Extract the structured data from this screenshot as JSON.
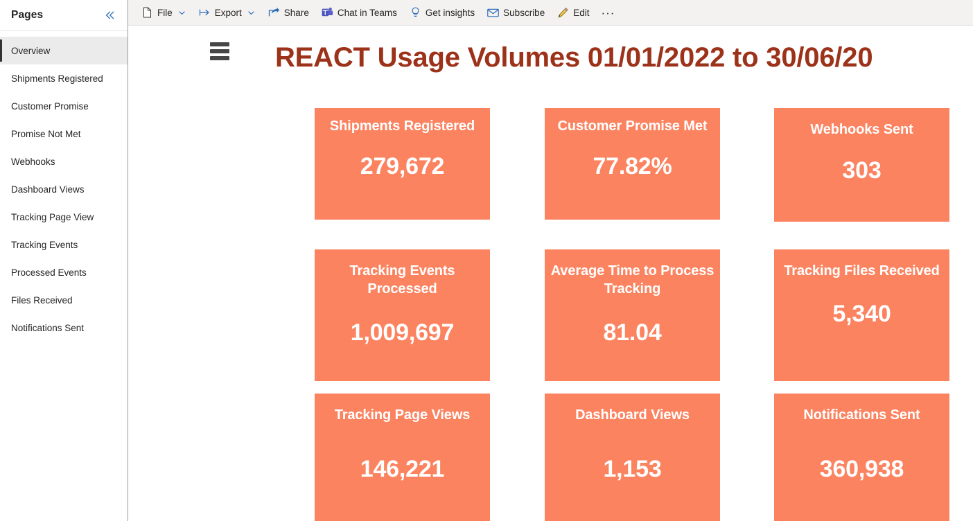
{
  "sidebar": {
    "title": "Pages",
    "collapse_icon": "double-chevron-left-icon",
    "items": [
      {
        "label": "Overview",
        "selected": true
      },
      {
        "label": "Shipments Registered",
        "selected": false
      },
      {
        "label": "Customer Promise",
        "selected": false
      },
      {
        "label": "Promise Not Met",
        "selected": false
      },
      {
        "label": "Webhooks",
        "selected": false
      },
      {
        "label": "Dashboard Views",
        "selected": false
      },
      {
        "label": "Tracking Page View",
        "selected": false
      },
      {
        "label": "Tracking Events",
        "selected": false
      },
      {
        "label": "Processed Events",
        "selected": false
      },
      {
        "label": "Files Received",
        "selected": false
      },
      {
        "label": "Notifications Sent",
        "selected": false
      }
    ]
  },
  "toolbar": {
    "file_label": "File",
    "export_label": "Export",
    "share_label": "Share",
    "chat_in_teams_label": "Chat in Teams",
    "get_insights_label": "Get insights",
    "subscribe_label": "Subscribe",
    "edit_label": "Edit",
    "overflow_label": "···",
    "icons": {
      "file": "file-icon",
      "export": "export-arrow-icon",
      "share": "share-arrow-icon",
      "teams": "teams-icon",
      "insights": "lightbulb-icon",
      "subscribe": "envelope-icon",
      "edit": "pencil-icon",
      "caret": "chevron-down-icon"
    }
  },
  "report": {
    "menu_icon": "hamburger-menu-icon",
    "title": "REACT Usage Volumes 01/01/2022 to 30/06/20",
    "title_color": "#9c3219",
    "card_color": "#fc8360",
    "card_text_color": "#ffffff",
    "cards": [
      {
        "title": "Shipments Registered",
        "value": "279,672"
      },
      {
        "title": "Customer Promise Met",
        "value": "77.82%"
      },
      {
        "title": "Webhooks Sent",
        "value": "303"
      },
      {
        "title": "Tracking Events Processed",
        "value": "1,009,697"
      },
      {
        "title": "Average Time to Process Tracking",
        "value": "81.04"
      },
      {
        "title": "Tracking Files Received",
        "value": "5,340"
      },
      {
        "title": "Tracking Page Views",
        "value": "146,221"
      },
      {
        "title": "Dashboard Views",
        "value": "1,153"
      },
      {
        "title": "Notifications Sent",
        "value": "360,938"
      }
    ]
  }
}
